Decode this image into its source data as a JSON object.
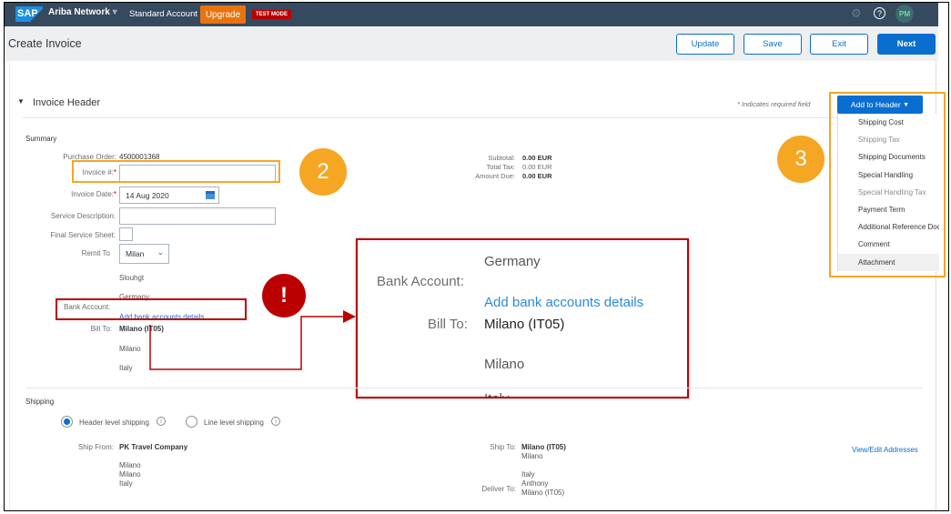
{
  "nav": {
    "logo": "SAP",
    "product": "Ariba Network",
    "account": "Standard Account",
    "upgrade": "Upgrade",
    "test_mode": "TEST MODE",
    "avatar": "PM"
  },
  "page": {
    "title": "Create Invoice"
  },
  "toolbar": {
    "update": "Update",
    "save": "Save",
    "exit": "Exit",
    "next": "Next"
  },
  "section": {
    "title": "Invoice Header",
    "required_note": "* Indicates required field"
  },
  "add_to_header": {
    "label": "Add to Header",
    "items": [
      {
        "label": "Shipping Cost",
        "disabled": false
      },
      {
        "label": "Shipping Tax",
        "disabled": true
      },
      {
        "label": "Shipping Documents",
        "disabled": false
      },
      {
        "label": "Special Handling",
        "disabled": false
      },
      {
        "label": "Special Handling Tax",
        "disabled": true
      },
      {
        "label": "Payment Term",
        "disabled": false
      },
      {
        "label": "Additional Reference Doc",
        "disabled": false
      },
      {
        "label": "Comment",
        "disabled": false
      },
      {
        "label": "Attachment",
        "disabled": false
      }
    ]
  },
  "summary": {
    "title": "Summary",
    "po_label": "Purchase Order:",
    "po_value": "4500001368",
    "invoice_no_label": "Invoice #:",
    "invoice_no_value": "",
    "invoice_date_label": "Invoice Date:",
    "invoice_date_value": "14 Aug 2020",
    "service_desc_label": "Service Description:",
    "service_desc_value": "",
    "final_sheet_label": "Final Service Sheet:",
    "remit_label": "Remit To",
    "remit_value": "Milan",
    "remit_line1": "Slouhgt",
    "remit_line2": "Germany",
    "bank_label": "Bank Account:",
    "bank_link": "Add bank accounts details",
    "bill_label": "Bill To:",
    "bill_value": "Milano (IT05)",
    "bill_line1": "Milano",
    "bill_line2": "Italy",
    "subtotal_label": "Subtotal:",
    "subtotal": "0.00 EUR",
    "tax_label": "Total Tax:",
    "tax": "0.00 EUR",
    "due_label": "Amount Due:",
    "due": "0.00 EUR"
  },
  "callouts": {
    "step2": "2",
    "step3": "3",
    "warning": "!"
  },
  "shipping": {
    "title": "Shipping",
    "header_level": "Header level shipping",
    "line_level": "Line level shipping",
    "selected": "header",
    "ship_from_label": "Ship From:",
    "ship_from": "PK Travel Company",
    "from_lines": [
      "Milano",
      "Milano",
      "Italy"
    ],
    "ship_to_label": "Ship To:",
    "ship_to": "Milano (IT05)",
    "to_line1": "Milano",
    "to_line2": "Italy",
    "deliver_label": "Deliver To:",
    "deliver_line1": "Anthony",
    "deliver_line2": "Milano (IT05)",
    "view_edit": "View/Edit Addresses"
  },
  "colors": {
    "nav": "#354a5f",
    "accent": "#0a6ed1",
    "upgrade": "#e9730c",
    "callout_orange": "#f5a623",
    "warning_red": "#bb0000"
  }
}
